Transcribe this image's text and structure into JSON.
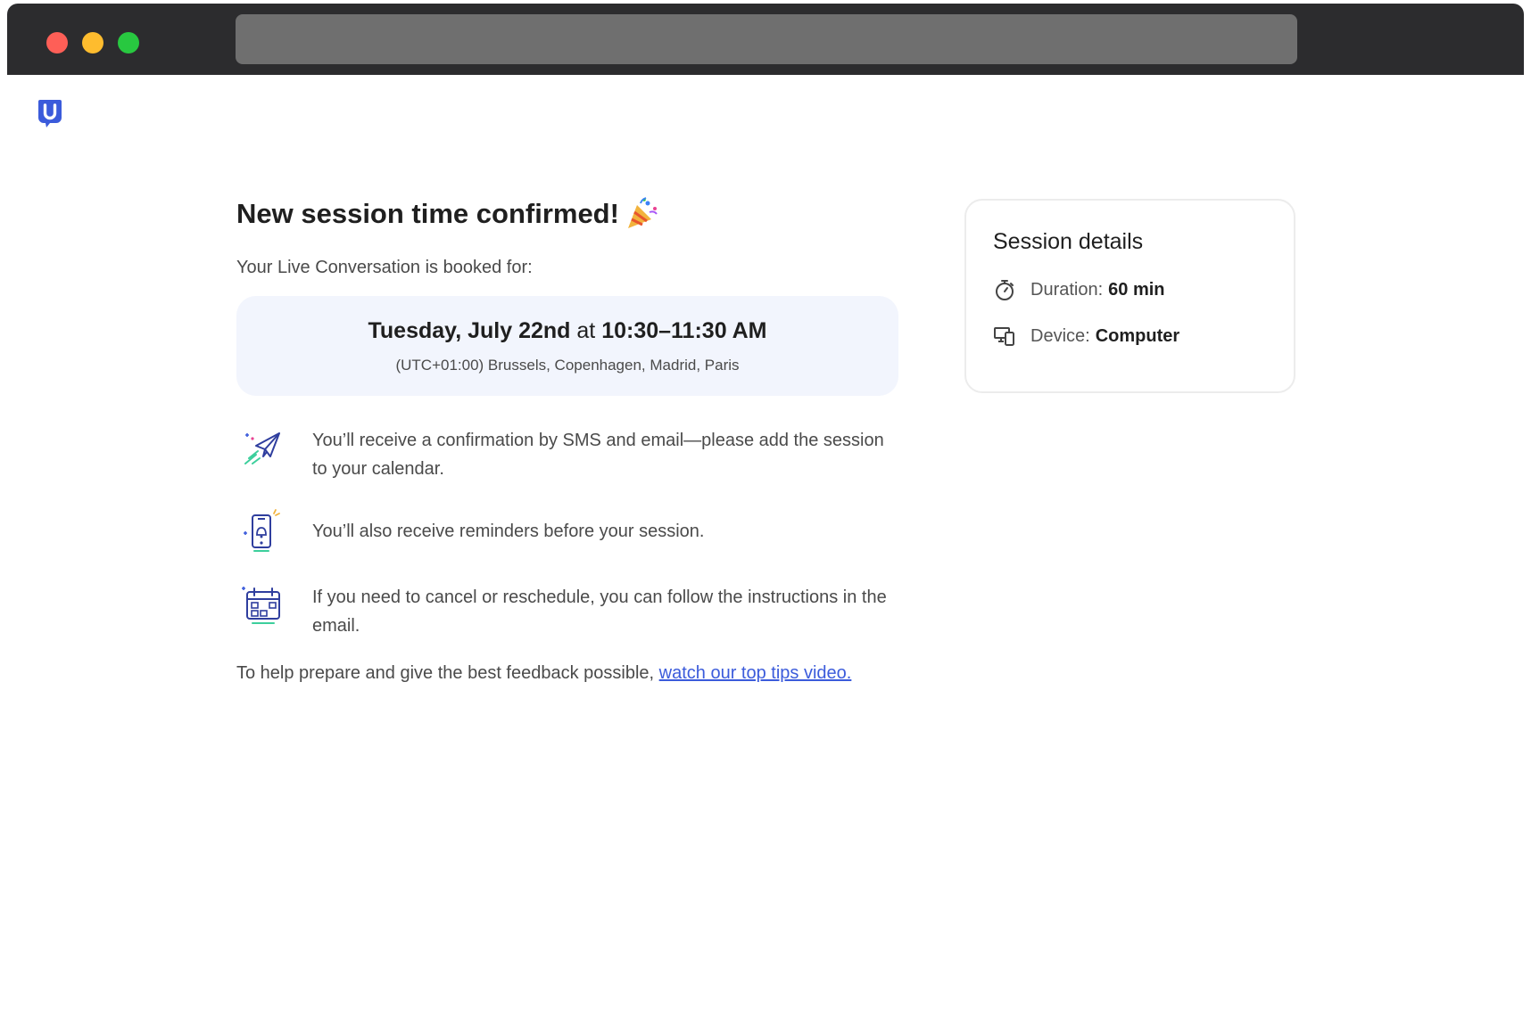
{
  "page": {
    "title": "New session time confirmed!",
    "intro": "Your Live Conversation is booked for:",
    "date": "Tuesday, July 22nd",
    "date_at": "at",
    "time": "10:30–11:30 AM",
    "timezone": "(UTC+01:00) Brussels, Copenhagen, Madrid, Paris",
    "info_items": [
      {
        "icon": "paper-plane-icon",
        "text": "You’ll receive a confirmation by SMS and email—please add the session to your calendar."
      },
      {
        "icon": "phone-reminder-icon",
        "text": "You’ll also receive reminders before your session."
      },
      {
        "icon": "calendar-icon",
        "text": "If you need to cancel or reschedule, you can follow the instructions in the email."
      }
    ],
    "tips_prefix": "To help prepare and give the best feedback possible, ",
    "tips_link": "watch our top tips video."
  },
  "details": {
    "title": "Session details",
    "duration_label": "Duration:",
    "duration_value": "60 min",
    "device_label": "Device:",
    "device_value": "Computer"
  },
  "colors": {
    "brand": "#3b5bdb",
    "date_box_bg": "#f2f5fd",
    "link": "#3b5bdb"
  }
}
